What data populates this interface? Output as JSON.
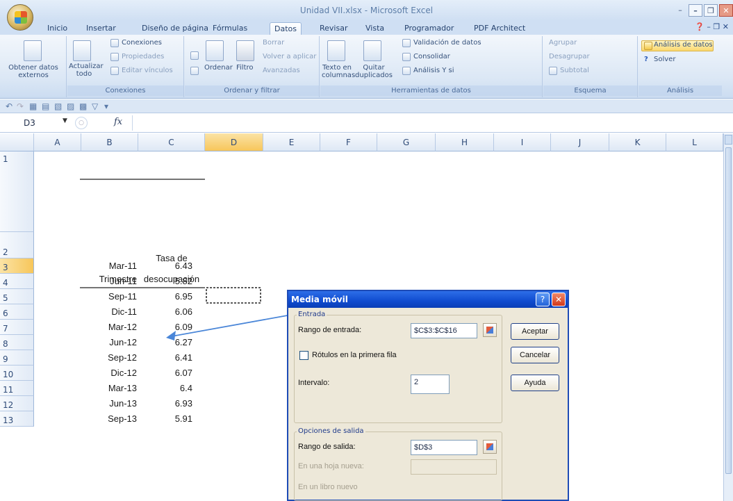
{
  "window": {
    "title": "Unidad VII.xlsx - Microsoft Excel"
  },
  "tabs": [
    "Inicio",
    "Insertar",
    "Diseño de página",
    "Fórmulas",
    "Datos",
    "Revisar",
    "Vista",
    "Programador",
    "PDF Architect"
  ],
  "active_tab": "Datos",
  "ribbon": {
    "external": {
      "label": "Obtener datos externos"
    },
    "connections": {
      "refresh": "Actualizar todo",
      "items": [
        "Conexiones",
        "Propiedades",
        "Editar vínculos"
      ],
      "group_label": "Conexiones"
    },
    "sort_filter": {
      "sort": "Ordenar",
      "filter": "Filtro",
      "items": [
        "Borrar",
        "Volver a aplicar",
        "Avanzadas"
      ],
      "group_label": "Ordenar y filtrar"
    },
    "data_tools": {
      "text_to_columns": "Texto en columnas",
      "remove_dupes": "Quitar duplicados",
      "items": [
        "Validación de datos",
        "Consolidar",
        "Análisis Y si"
      ],
      "group_label": "Herramientas de datos"
    },
    "outline": {
      "items": [
        "Agrupar",
        "Desagrupar",
        "Subtotal"
      ],
      "group_label": "Esquema"
    },
    "analysis": {
      "items": [
        "Análisis de datos",
        "Solver"
      ],
      "group_label": "Análisis"
    }
  },
  "formula_bar": {
    "cell_ref": "D3",
    "fx": "fx",
    "formula": ""
  },
  "columns": [
    "A",
    "B",
    "C",
    "D",
    "E",
    "F",
    "G",
    "H",
    "I",
    "J",
    "K",
    "L"
  ],
  "rows": [
    "1",
    "2",
    "3",
    "4",
    "5",
    "6",
    "7",
    "8",
    "9",
    "10",
    "11",
    "12",
    "13"
  ],
  "sheet": {
    "header_b": "Trimestre",
    "header_c_line1": "Tasa de",
    "header_c_line2": "desocupación",
    "data": [
      [
        "Mar-11",
        "6.43"
      ],
      [
        "Jun-11",
        "5.82"
      ],
      [
        "Sep-11",
        "6.95"
      ],
      [
        "Dic-11",
        "6.06"
      ],
      [
        "Mar-12",
        "6.09"
      ],
      [
        "Jun-12",
        "6.27"
      ],
      [
        "Sep-12",
        "6.41"
      ],
      [
        "Dic-12",
        "6.07"
      ],
      [
        "Mar-13",
        "6.4"
      ],
      [
        "Jun-13",
        "6.93"
      ],
      [
        "Sep-13",
        "5.91"
      ]
    ]
  },
  "dialog": {
    "title": "Media móvil",
    "input_section": "Entrada",
    "input_range_label": "Rango de entrada:",
    "input_range_value": "$C$3:$C$16",
    "labels_first_row": "Rótulos en la primera fila",
    "interval_label": "Intervalo:",
    "interval_value": "2",
    "output_section": "Opciones de salida",
    "output_range_label": "Rango de salida:",
    "output_range_value": "$D$3",
    "new_sheet_label": "En una hoja nueva:",
    "new_book_label": "En un libro nuevo",
    "ok": "Aceptar",
    "cancel": "Cancelar",
    "help": "Ayuda"
  },
  "colors": {
    "accent": "#1d4bb6",
    "selection": "#f7c65a",
    "arrow": "#4a86d8"
  }
}
